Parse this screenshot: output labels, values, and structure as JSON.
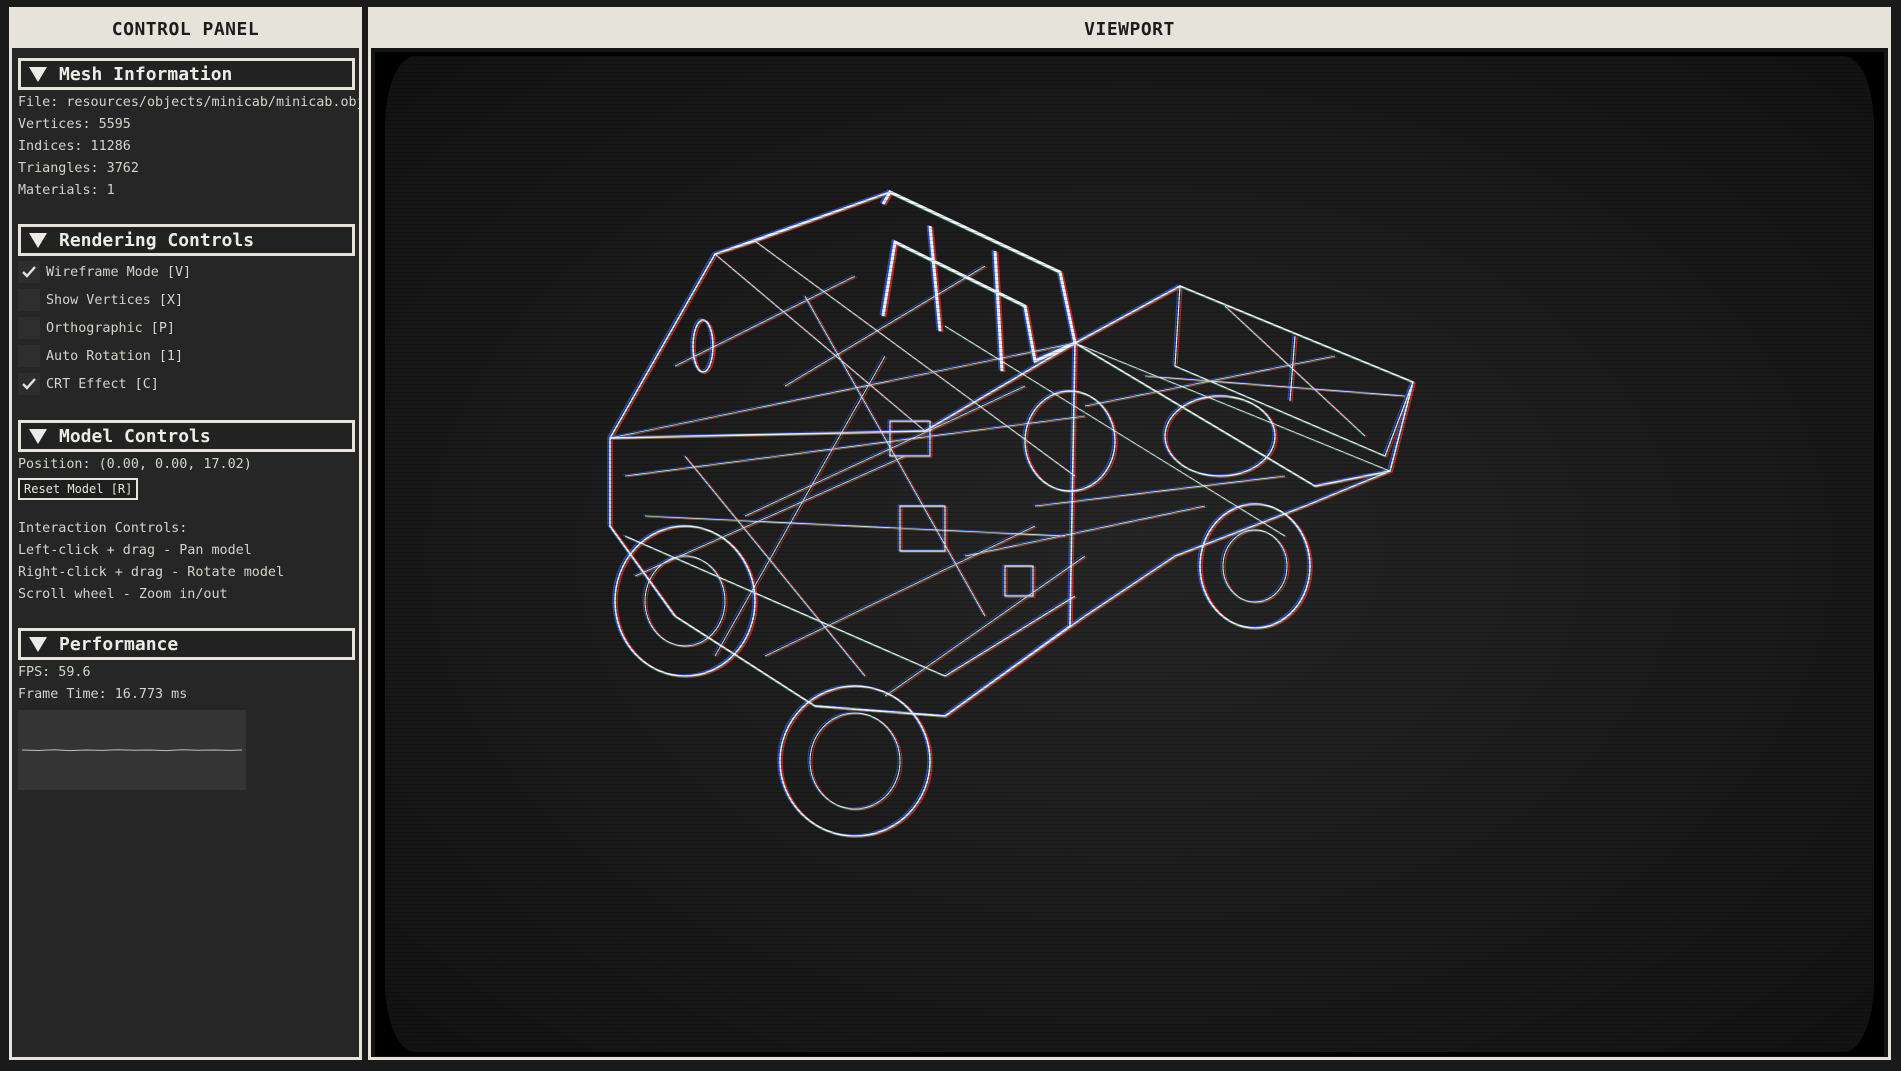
{
  "control_panel": {
    "title": "CONTROL PANEL",
    "mesh_info": {
      "header": "Mesh Information",
      "file": "File: resources/objects/minicab/minicab.obj",
      "vertices": "Vertices: 5595",
      "indices": "Indices: 11286",
      "triangles": "Triangles: 3762",
      "materials": "Materials: 1"
    },
    "rendering": {
      "header": "Rendering Controls",
      "options": [
        {
          "label": "Wireframe Mode [V]",
          "checked": true
        },
        {
          "label": "Show Vertices [X]",
          "checked": false
        },
        {
          "label": "Orthographic [P]",
          "checked": false
        },
        {
          "label": "Auto Rotation [1]",
          "checked": false
        },
        {
          "label": "CRT Effect [C]",
          "checked": true
        }
      ]
    },
    "model": {
      "header": "Model Controls",
      "position": "Position: (0.00, 0.00, 17.02)",
      "reset_label": "Reset Model [R]",
      "interaction_title": "Interaction Controls:",
      "interaction_lines": [
        "Left-click + drag - Pan model",
        "Right-click + drag - Rotate model",
        "Scroll wheel - Zoom in/out"
      ]
    },
    "performance": {
      "header": "Performance",
      "fps": "FPS: 59.6",
      "frame_time": "Frame Time: 16.773 ms"
    }
  },
  "viewport": {
    "title": "VIEWPORT"
  },
  "colors": {
    "panel_border": "#e6e4da",
    "panel_bg": "#262626",
    "wire": "#ffffff",
    "wire_red": "#ff3030",
    "wire_blue": "#3060ff"
  }
}
